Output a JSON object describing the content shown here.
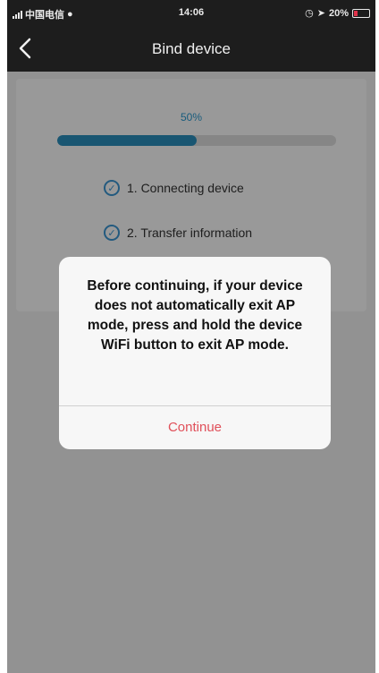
{
  "status_bar": {
    "carrier": "中国电信",
    "time": "14:06",
    "battery": "20%"
  },
  "nav": {
    "title": "Bind device"
  },
  "progress": {
    "label": "50%",
    "value": 0.5
  },
  "steps": [
    {
      "label": "1. Connecting device"
    },
    {
      "label": "2. Transfer information"
    }
  ],
  "dialog": {
    "message": "Before continuing, if your device does not automatically exit AP mode, press and hold the device WiFi button to exit AP mode.",
    "button": "Continue"
  },
  "colors": {
    "accent": "#2b8fbf",
    "continue": "#e0505a",
    "battery_low": "#e2334a"
  }
}
